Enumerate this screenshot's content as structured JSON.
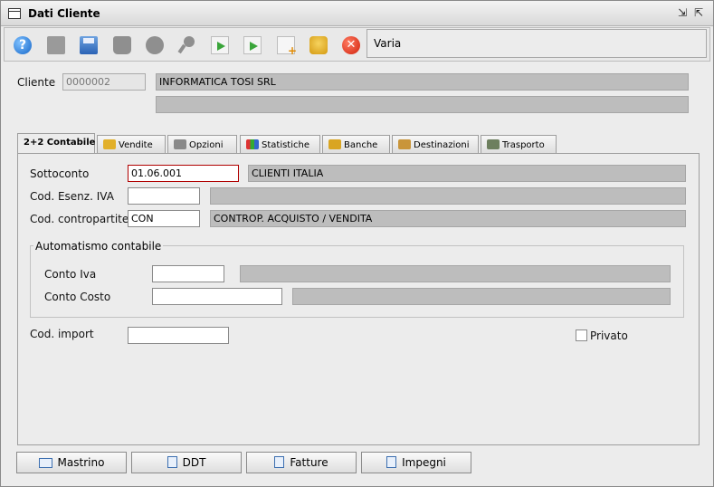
{
  "window": {
    "title": "Dati Cliente"
  },
  "toolbar": {
    "items": [
      "help-icon",
      "document-icon",
      "save-icon",
      "trash-icon",
      "binoculars-icon",
      "key-icon",
      "forward-icon",
      "next-document-icon",
      "new-document-icon",
      "user-envelope-icon",
      "close-icon"
    ],
    "varia_label": "Varia"
  },
  "cliente": {
    "label": "Cliente",
    "code": "0000002",
    "name": "INFORMATICA TOSI SRL",
    "name2": ""
  },
  "tabs": [
    {
      "label": "Contabile",
      "prefix": "2+2"
    },
    {
      "label": "Vendite"
    },
    {
      "label": "Opzioni"
    },
    {
      "label": "Statistiche"
    },
    {
      "label": "Banche"
    },
    {
      "label": "Destinazioni"
    },
    {
      "label": "Trasporto"
    }
  ],
  "form": {
    "sottoconto": {
      "label": "Sottoconto",
      "code": "01.06.001",
      "desc": "CLIENTI ITALIA"
    },
    "esenz": {
      "label": "Cod. Esenz. IVA",
      "code": "",
      "desc": ""
    },
    "contropartite": {
      "label": "Cod. contropartite",
      "code": "CON",
      "desc": "CONTROP. ACQUISTO / VENDITA"
    },
    "automatismo": {
      "title": "Automatismo contabile",
      "conto_iva": {
        "label": "Conto Iva",
        "code": "",
        "desc": ""
      },
      "conto_costo": {
        "label": "Conto Costo",
        "code": "",
        "desc": ""
      }
    },
    "import": {
      "label": "Cod. import",
      "value": ""
    },
    "privato": {
      "label": "Privato",
      "checked": false
    }
  },
  "buttons": {
    "mastrino": "Mastrino",
    "ddt": "DDT",
    "fatture": "Fatture",
    "impegni": "Impegni"
  }
}
